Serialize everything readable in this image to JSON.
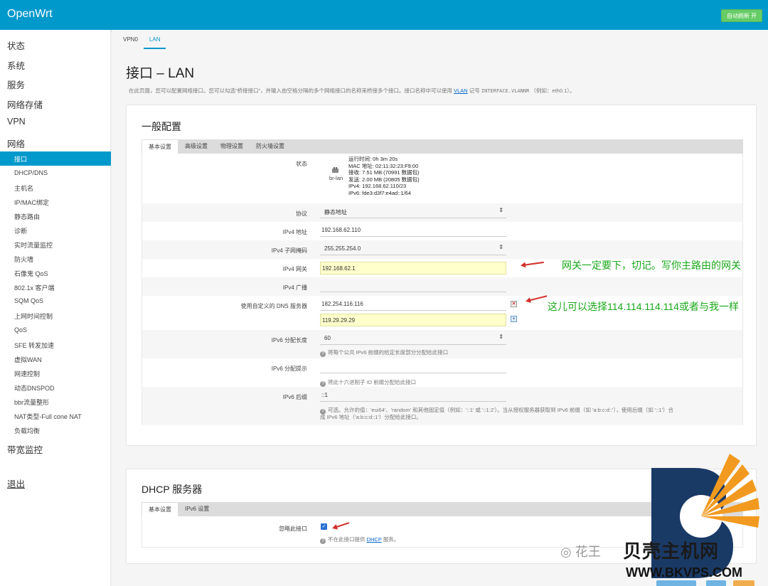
{
  "header": {
    "brand": "OpenWrt",
    "refresh_button": "自动刷新 开"
  },
  "sidebar": {
    "top_items": [
      "状态",
      "系统",
      "服务",
      "网络存储",
      "VPN",
      "网络"
    ],
    "network_items": [
      "接口",
      "DHCP/DNS",
      "主机名",
      "IP/MAC绑定",
      "静态路由",
      "诊断",
      "实时流量监控",
      "防火墙",
      "石像鬼 QoS",
      "802.1x 客户端",
      "SQM QoS",
      "上网时间控制",
      "QoS",
      "SFE 转发加速",
      "虚拟WAN",
      "网速控制",
      "动态DNSPOD",
      "bbr流量整形",
      "NAT类型-Full cone NAT",
      "负载均衡"
    ],
    "bandwidth": "带宽监控",
    "logout": "退出"
  },
  "main": {
    "tabs": [
      "VPN0",
      "LAN"
    ],
    "title": "接口 – LAN",
    "desc_prefix": "在此页面，您可以配置网络接口。您可以勾选“桥接接口”，并输入由空格分隔的多个网络接口的名称来桥接多个接口。接口名称中可以使用",
    "desc_link": "VLAN",
    "desc_mid": "记号",
    "desc_code": "INTERFACE.VLANNR",
    "desc_suffix": "（例如：eth0.1）。"
  },
  "general": {
    "title": "一般配置",
    "subtabs": [
      "基本设置",
      "高级设置",
      "物理设置",
      "防火墙设置"
    ],
    "status_label": "状态",
    "device": "br-lan",
    "status_lines": [
      "运行时间: 0h 3m 20s",
      "MAC 地址: 02:11:32:23:F9:00",
      "接收: 7.51 MB (70991 数据包)",
      "发送: 2.00 MB (20805 数据包)",
      "IPv4: 192.168.62.110/23",
      "IPv6: fde3:d3f7:e4ad::1/64"
    ],
    "protocol_label": "协议",
    "protocol_value": "静态地址",
    "ipv4addr_label": "IPv4 地址",
    "ipv4addr_value": "192.168.62.110",
    "netmask_label": "IPv4 子网掩码",
    "netmask_value": "255.255.254.0",
    "gateway_label": "IPv4 网关",
    "gateway_value": "192.168.62.1",
    "broadcast_label": "IPv4 广播",
    "broadcast_value": "",
    "dns_label": "使用自定义的 DNS 服务器",
    "dns_values": [
      "182.254.116.116",
      "119.29.29.29"
    ],
    "ip6len_label": "IPv6 分配长度",
    "ip6len_value": "60",
    "ip6len_help": "将每个公共 IPv6 前缀的给定长度部分分配给此接口",
    "ip6hint_label": "IPv6 分配提示",
    "ip6hint_value": "",
    "ip6hint_help": "将此十六进制子 ID 前缀分配给此接口",
    "ip6suffix_label": "IPv6 后缀",
    "ip6suffix_value": "::1",
    "ip6suffix_help_1": "可选。允许的值：'eui64'、'random' 和其他固定值（例如：'::1' 或 '::1:2'）。当从授权服务器获取到 IPv6 前缀（如 'a:b:c:d::'），使用后缀（如 '::1'）合",
    "ip6suffix_help_2": "成 IPv6 地址（'a:b:c:d::1'）分配给此接口。"
  },
  "dhcp": {
    "title": "DHCP 服务器",
    "subtabs": [
      "基本设置",
      "IPv6 设置"
    ],
    "ignore_label": "忽略此接口",
    "ignore_help_prefix": "不在此接口提供",
    "ignore_help_link": "DHCP",
    "ignore_help_suffix": "服务。"
  },
  "annotations": {
    "gateway_note": "网关一定要下，切记。写你主路由的网关",
    "dns_note": "这儿可以选择114.114.114.114或者与我一样"
  },
  "watermark": {
    "wechat": "花王",
    "site": "贝壳主机网",
    "url": "WWW.BKVPS.COM"
  },
  "colors": {
    "header": "#0099cc",
    "accent": "#0099cc",
    "annotation": "#1aa81a",
    "arrow": "#d0302a"
  }
}
